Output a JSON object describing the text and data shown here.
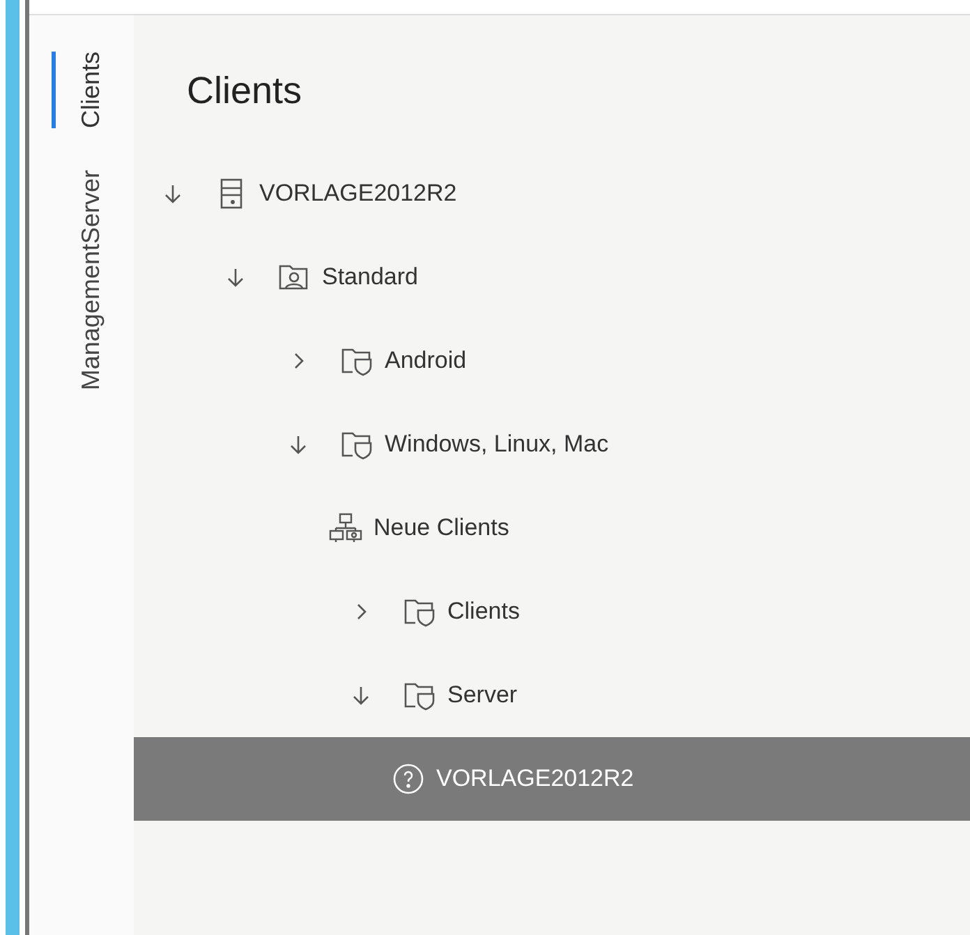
{
  "side_tabs": [
    {
      "label": "Clients",
      "selected": true
    },
    {
      "label": "ManagementServer",
      "selected": false
    }
  ],
  "title": "Clients",
  "tree": [
    {
      "label": "VORLAGE2012R2",
      "kind": "server",
      "expanded": true,
      "selected": false,
      "children": [
        {
          "label": "Standard",
          "kind": "group",
          "expanded": true,
          "selected": false,
          "children": [
            {
              "label": "Android",
              "kind": "shieldfolder",
              "expanded": false,
              "selected": false
            },
            {
              "label": "Windows, Linux, Mac",
              "kind": "shieldfolder",
              "expanded": true,
              "selected": false,
              "children": [
                {
                  "label": "Neue Clients",
                  "kind": "network",
                  "selected": false
                },
                {
                  "label": "Clients",
                  "kind": "shieldfolder",
                  "expanded": false,
                  "selected": false
                },
                {
                  "label": "Server",
                  "kind": "shieldfolder",
                  "expanded": true,
                  "selected": false,
                  "children": [
                    {
                      "label": "VORLAGE2012R2",
                      "kind": "unknown",
                      "selected": true
                    }
                  ]
                }
              ]
            }
          ]
        }
      ]
    }
  ]
}
